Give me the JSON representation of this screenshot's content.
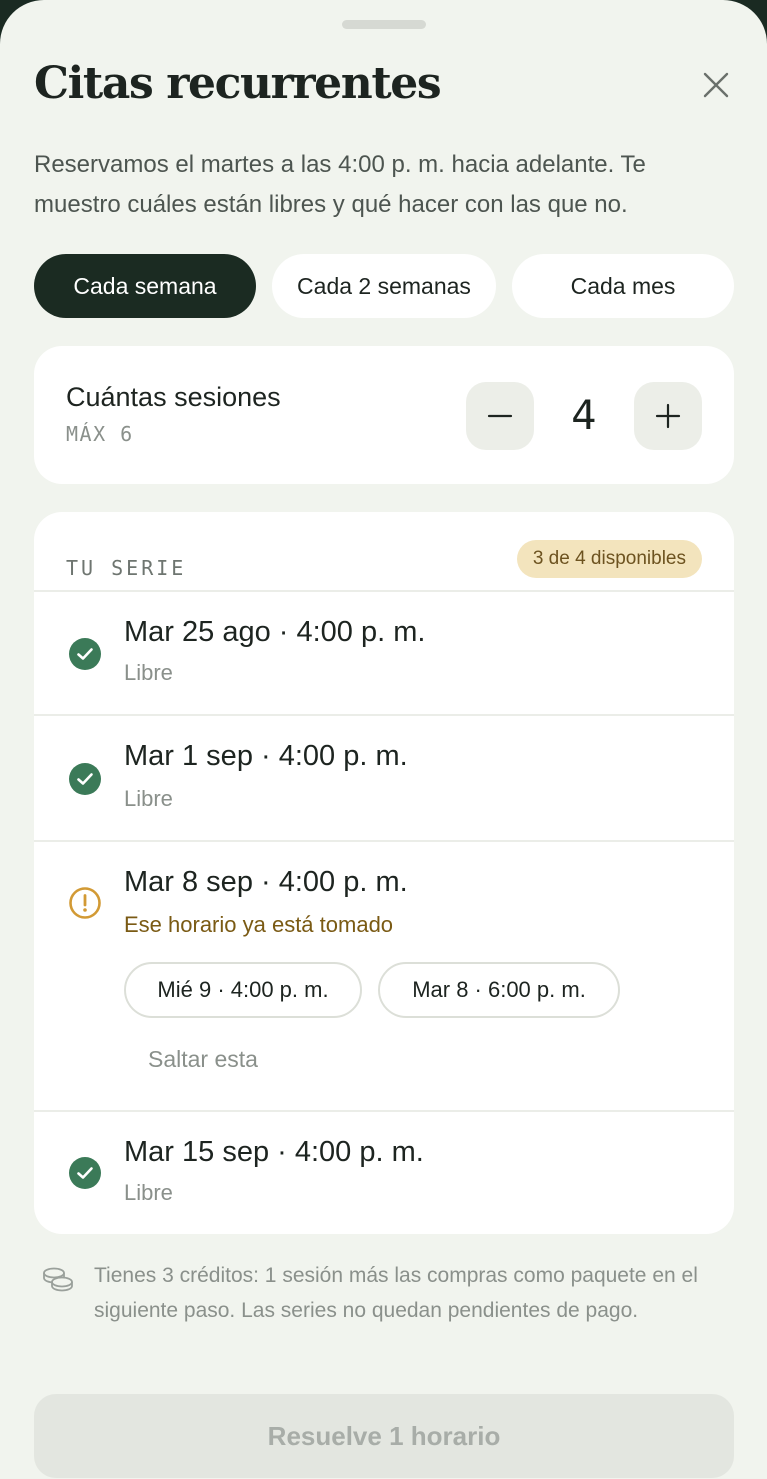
{
  "header": {
    "title": "Citas recurrentes",
    "subtitle": "Reservamos el martes a las 4:00 p. m. hacia adelante. Te muestro cuáles están libres y qué hacer con las que no."
  },
  "frequency": {
    "options": [
      {
        "label": "Cada semana",
        "selected": true
      },
      {
        "label": "Cada 2 semanas",
        "selected": false
      },
      {
        "label": "Cada mes",
        "selected": false
      }
    ]
  },
  "sessions": {
    "label": "Cuántas sesiones",
    "max_label": "MÁX 6",
    "value": "4"
  },
  "series": {
    "heading": "TU SERIE",
    "badge": "3 de 4 disponibles",
    "items": [
      {
        "title": "Mar 25 ago · 4:00 p. m.",
        "status": "Libre",
        "state": "free"
      },
      {
        "title": "Mar 1 sep · 4:00 p. m.",
        "status": "Libre",
        "state": "free"
      },
      {
        "title": "Mar 8 sep · 4:00 p. m.",
        "status": "Ese horario ya está tomado",
        "state": "conflict",
        "alternatives": [
          "Mié 9 · 4:00 p. m.",
          "Mar 8 · 6:00 p. m."
        ],
        "skip_label": "Saltar esta"
      },
      {
        "title": "Mar 15 sep · 4:00 p. m.",
        "status": "Libre",
        "state": "free"
      }
    ]
  },
  "footer": {
    "note": "Tienes 3 créditos: 1 sesión más las compras como paquete en el siguiente paso. Las series no quedan pendientes de pago.",
    "note_icon": "coins-icon",
    "cta_label": "Resuelve 1 horario",
    "cta_enabled": false
  },
  "colors": {
    "background": "#f1f4ee",
    "accent_dark": "#1b2b22",
    "success": "#3b7a58",
    "warning": "#d29a35",
    "badge_bg": "#f3e4bd"
  }
}
